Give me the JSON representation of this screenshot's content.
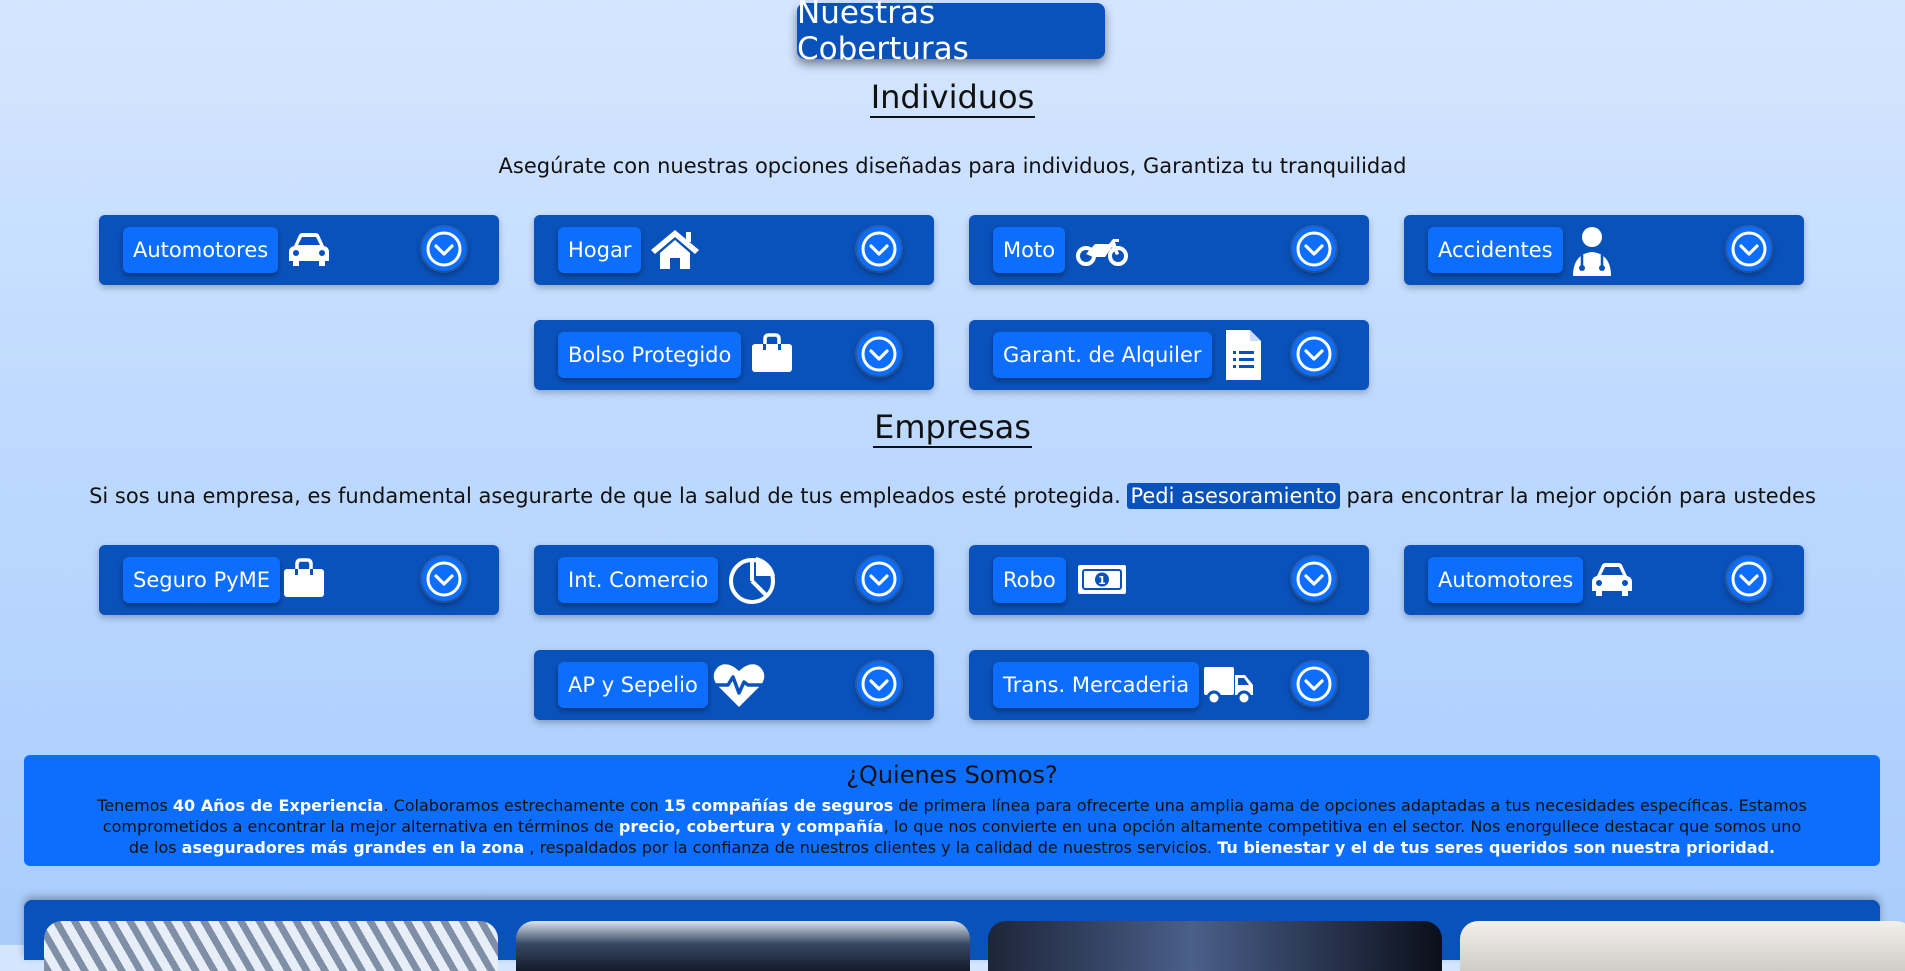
{
  "header": {
    "title": "Nuestras Coberturas"
  },
  "individuos": {
    "title": "Individuos",
    "description": "Asegúrate con nuestras opciones diseñadas para individuos, Garantiza tu tranquilidad",
    "cards": [
      {
        "label": "Automotores",
        "icon": "car-icon"
      },
      {
        "label": "Hogar",
        "icon": "house-icon"
      },
      {
        "label": "Moto",
        "icon": "motorcycle-icon"
      },
      {
        "label": "Accidentes",
        "icon": "doctor-icon"
      },
      {
        "label": "Bolso Protegido",
        "icon": "bag-icon"
      },
      {
        "label": "Garant. de Alquiler",
        "icon": "document-icon"
      }
    ]
  },
  "empresas": {
    "title": "Empresas",
    "description_before": "Si sos una empresa, es fundamental asegurarte de que la salud de tus empleados esté protegida.",
    "highlight": "Pedi asesoramiento",
    "description_after": "para encontrar la mejor opción para ustedes",
    "cards": [
      {
        "label": "Seguro PyME",
        "icon": "briefcase-icon"
      },
      {
        "label": "Int. Comercio",
        "icon": "pie-chart-icon"
      },
      {
        "label": "Robo",
        "icon": "money-bill-icon"
      },
      {
        "label": "Automotores",
        "icon": "car-icon"
      },
      {
        "label": "AP y Sepelio",
        "icon": "heart-pulse-icon"
      },
      {
        "label": "Trans. Mercaderia",
        "icon": "truck-icon"
      }
    ]
  },
  "about": {
    "title": "¿Quienes Somos?",
    "p1": "Tenemos",
    "b1": "40 Años de Experiencia",
    "p2": ". Colaboramos estrechamente con",
    "b2": "15 compañías de seguros",
    "p3": "de primera línea para ofrecerte una amplia gama de opciones adaptadas a tus necesidades específicas. Estamos comprometidos a encontrar la mejor alternativa en términos de",
    "b3": "precio, cobertura y compañía",
    "p4": ", lo que nos convierte en una opción altamente competitiva en el sector. Nos enorgullece destacar que somos uno de los",
    "b4": "aseguradores más grandes en la zona",
    "p5": ", respaldados por la confianza de nuestros clientes y la calidad de nuestros servicios.",
    "b5": "Tu bienestar y el de tus seres queridos son nuestra prioridad."
  },
  "colors": {
    "card_bg": "#0a52bb",
    "accent": "#0d6efd",
    "background": "#c7ddff"
  }
}
